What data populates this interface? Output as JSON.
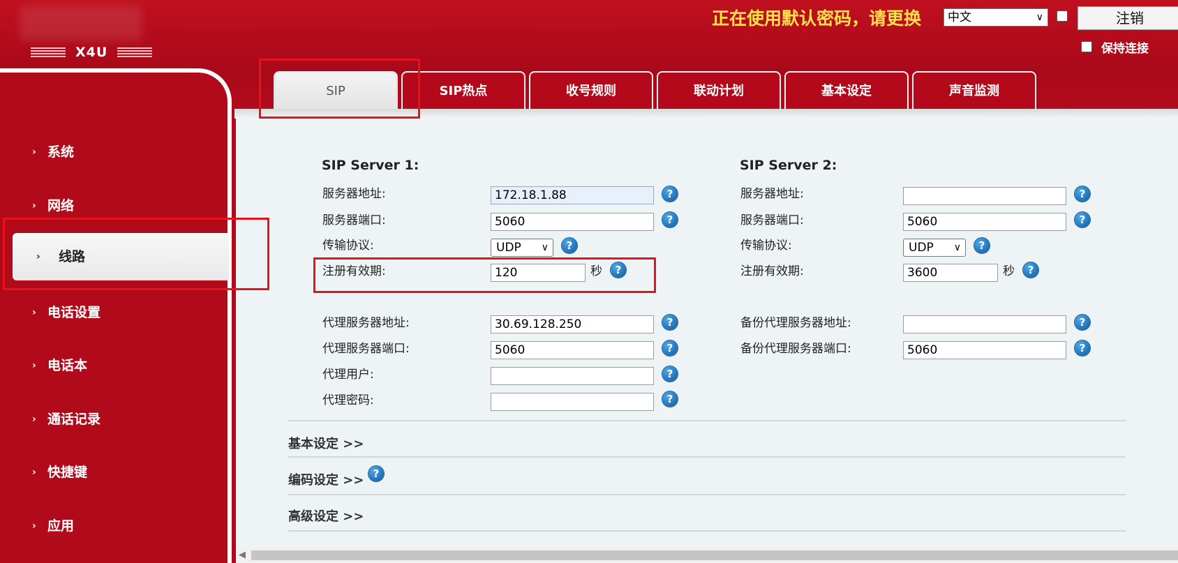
{
  "header": {
    "logo_text": "X4U",
    "warning": "正在使用默认密码，请更换",
    "language": "中文",
    "logout_label": "注销",
    "keep_connected_label": "保持连接"
  },
  "tabs": [
    {
      "label": "SIP",
      "active": true
    },
    {
      "label": "SIP热点"
    },
    {
      "label": "收号规则"
    },
    {
      "label": "联动计划"
    },
    {
      "label": "基本设定"
    },
    {
      "label": "声音监测"
    }
  ],
  "sidebar": {
    "items": [
      {
        "label": "系统"
      },
      {
        "label": "网络"
      },
      {
        "label": "线路",
        "active": true
      },
      {
        "label": "电话设置"
      },
      {
        "label": "电话本"
      },
      {
        "label": "通话记录"
      },
      {
        "label": "快捷键"
      },
      {
        "label": "应用"
      }
    ]
  },
  "server1": {
    "title": "SIP Server 1:",
    "fields": {
      "server_address": {
        "label": "服务器地址:",
        "value": "172.18.1.88"
      },
      "server_port": {
        "label": "服务器端口:",
        "value": "5060"
      },
      "transport": {
        "label": "传输协议:",
        "value": "UDP"
      },
      "registration_expiry": {
        "label": "注册有效期:",
        "value": "120",
        "unit": "秒"
      },
      "proxy_address": {
        "label": "代理服务器地址:",
        "value": "30.69.128.250"
      },
      "proxy_port": {
        "label": "代理服务器端口:",
        "value": "5060"
      },
      "proxy_user": {
        "label": "代理用户:",
        "value": ""
      },
      "proxy_password": {
        "label": "代理密码:",
        "value": ""
      }
    }
  },
  "server2": {
    "title": "SIP Server 2:",
    "fields": {
      "server_address": {
        "label": "服务器地址:",
        "value": ""
      },
      "server_port": {
        "label": "服务器端口:",
        "value": "5060"
      },
      "transport": {
        "label": "传输协议:",
        "value": "UDP"
      },
      "registration_expiry": {
        "label": "注册有效期:",
        "value": "3600",
        "unit": "秒"
      },
      "backup_proxy_address": {
        "label": "备份代理服务器地址:",
        "value": ""
      },
      "backup_proxy_port": {
        "label": "备份代理服务器端口:",
        "value": "5060"
      }
    }
  },
  "sections": [
    {
      "label": "基本设定 >>"
    },
    {
      "label": "编码设定 >>"
    },
    {
      "label": "高级设定 >>"
    }
  ],
  "icons": {
    "help": "?",
    "chevron": "∨",
    "nav_arrow": "›",
    "scroll_left": "◀"
  },
  "colors": {
    "brand_red": "#b10a1b",
    "warning_yellow": "#ffe14a",
    "highlight_red": "#e3141a",
    "help_blue": "#1f6fb3"
  }
}
